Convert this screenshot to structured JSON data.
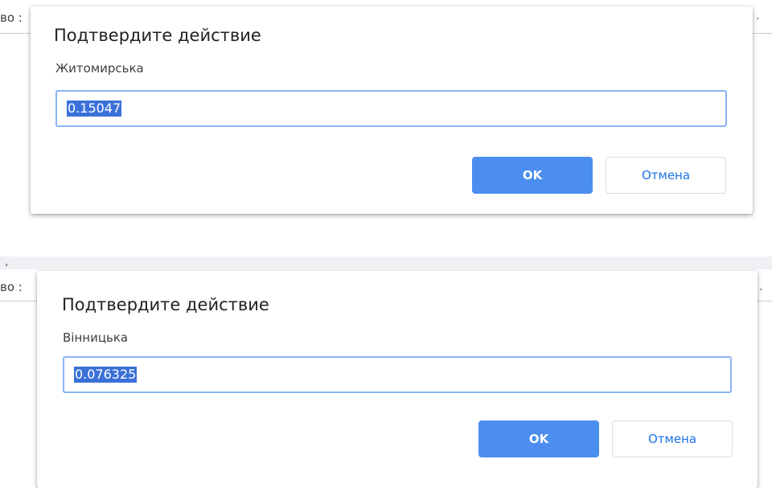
{
  "dialogs": [
    {
      "title": "Подтвердите действие",
      "label": "Житомирська",
      "input_value": "0.15047",
      "ok_label": "OK",
      "cancel_label": "Отмена"
    },
    {
      "title": "Подтвердите действие",
      "label": "Вінницька",
      "input_value": "0.076325",
      "ok_label": "OK",
      "cancel_label": "Отмена"
    }
  ],
  "background": {
    "edge_text_top": "во :",
    "edge_text_bottom": "во :"
  },
  "colors": {
    "ok_button": "#4c8ef0",
    "input_border": "#8ab4f8",
    "selection": "#3a71d8",
    "cancel_text": "#1a73e8"
  }
}
